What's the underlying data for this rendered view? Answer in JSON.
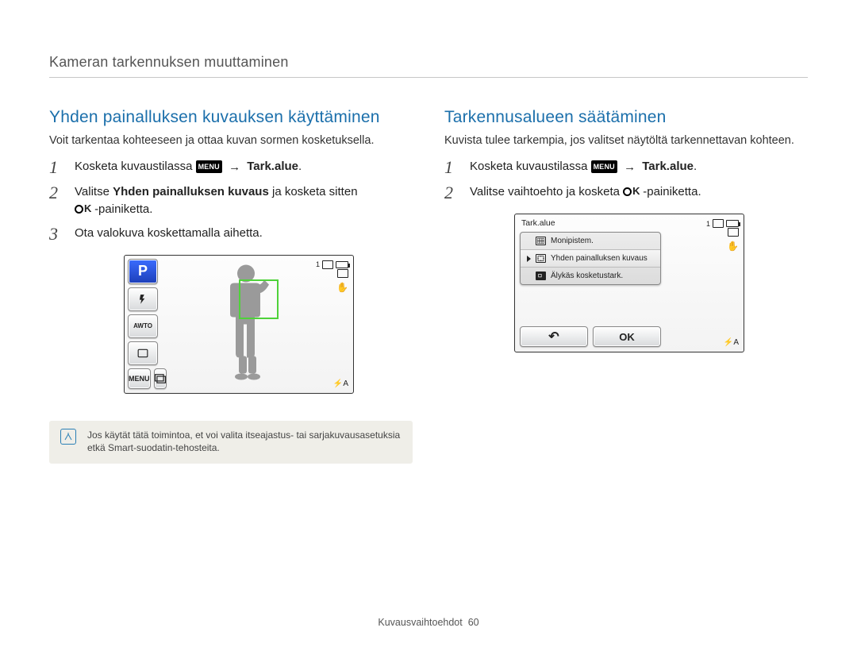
{
  "header": "Kameran tarkennuksen muuttaminen",
  "footer": {
    "label": "Kuvausvaihtoehdot",
    "page": "60"
  },
  "icons": {
    "menu_chip": "MENU",
    "arrow": "→",
    "ok": "OK"
  },
  "left": {
    "title": "Yhden painalluksen kuvauksen käyttäminen",
    "sub": "Voit tarkentaa kohteeseen ja ottaa kuvan sormen kosketuksella.",
    "steps": [
      {
        "n": "1",
        "pre": "Kosketa kuvaustilassa ",
        "post_bold": "Tark.alue",
        "post_tail": "."
      },
      {
        "n": "2",
        "a": "Valitse ",
        "b_bold": "Yhden painalluksen kuvaus",
        "c": " ja kosketa sitten ",
        "d_tail": "-painiketta."
      },
      {
        "n": "3",
        "text": "Ota valokuva koskettamalla aihetta."
      }
    ],
    "screenshot": {
      "mode_chip": "P",
      "left_icons": [
        "flash-auto",
        "awb",
        "single-shot"
      ],
      "menu_label": "MENU",
      "counter": "1",
      "bottom_right": "A"
    },
    "note": "Jos käytät tätä toimintoa, et voi valita itseajastus- tai sarjakuvausasetuksia etkä Smart-suodatin-tehosteita."
  },
  "right": {
    "title": "Tarkennusalueen säätäminen",
    "sub": "Kuvista tulee tarkempia, jos valitset näytöltä tarkennettavan kohteen.",
    "steps": [
      {
        "n": "1",
        "pre": "Kosketa kuvaustilassa ",
        "post_bold": "Tark.alue",
        "post_tail": "."
      },
      {
        "n": "2",
        "a": "Valitse vaihtoehto ja kosketa ",
        "d_tail": "-painiketta."
      }
    ],
    "menu_shot": {
      "title": "Tark.alue",
      "items": [
        "Monipistem.",
        "Yhden painalluksen kuvaus",
        "Älykäs kosketustark."
      ],
      "selected_index": 1,
      "back": "↶",
      "ok": "OK",
      "counter": "1",
      "bottom_right": "A"
    }
  }
}
